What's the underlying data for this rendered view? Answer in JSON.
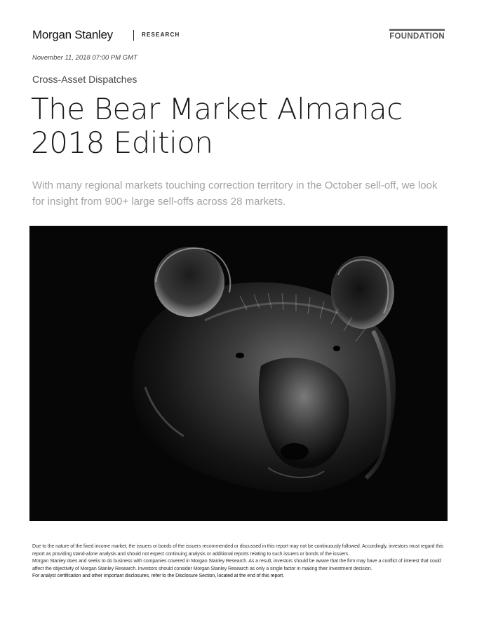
{
  "header": {
    "brand": "Morgan Stanley",
    "section": "RESEARCH",
    "series": "FOUNDATION"
  },
  "meta": {
    "date": "November 11, 2018 07:00 PM GMT"
  },
  "article": {
    "kicker": "Cross-Asset Dispatches",
    "title_line1": "The Bear Market Almanac",
    "title_line2": "2018 Edition",
    "subtitle": "With many regional markets touching correction territory in the October sell-off, we look for insight from 900+ large sell-offs across 28 markets."
  },
  "disclaimer": {
    "p1": "Due to the nature of the fixed income market, the issuers or bonds of the issuers recommended or discussed in this report may not be continuously followed. Accordingly, investors must regard this report as providing stand-alone analysis and should not expect continuing analysis or additional reports relating to such issuers or bonds of the issuers.",
    "p2": "Morgan Stanley does and seeks to do business with companies covered in Morgan Stanley Research. As a result, investors should be aware that the firm may have a conflict of interest that could affect the objectivity of Morgan Stanley Research. Investors should consider Morgan Stanley Research as only a single factor in making their investment decision.",
    "p3": "For analyst certification and other important disclosures, refer to the Disclosure Section, located at the end of this report."
  }
}
